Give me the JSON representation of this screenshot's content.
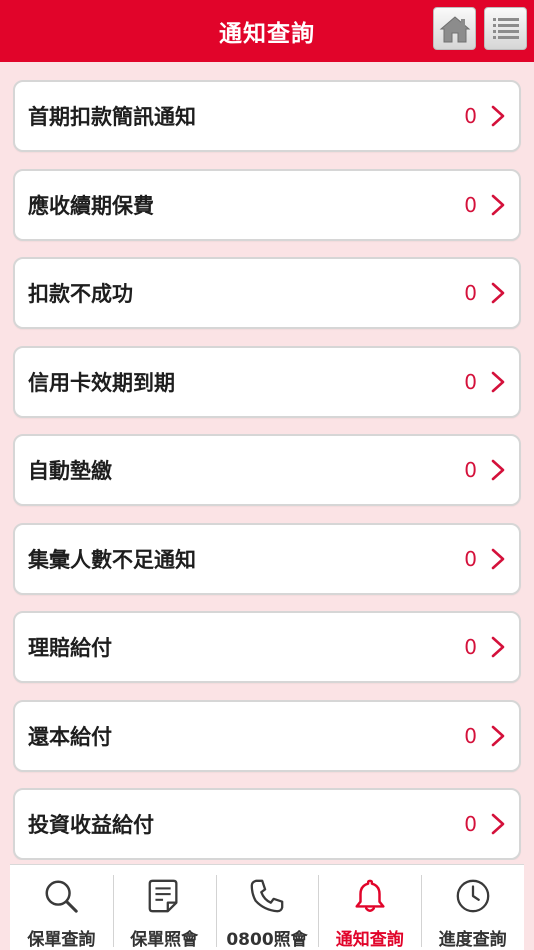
{
  "header": {
    "title": "通知查詢"
  },
  "notifications": [
    {
      "label": "首期扣款簡訊通知",
      "count": "0"
    },
    {
      "label": "應收續期保費",
      "count": "0"
    },
    {
      "label": "扣款不成功",
      "count": "0"
    },
    {
      "label": "信用卡效期到期",
      "count": "0"
    },
    {
      "label": "自動墊繳",
      "count": "0"
    },
    {
      "label": "集彙人數不足通知",
      "count": "0"
    },
    {
      "label": "理賠給付",
      "count": "0"
    },
    {
      "label": "還本給付",
      "count": "0"
    },
    {
      "label": "投資收益給付",
      "count": "0"
    }
  ],
  "tabs": [
    {
      "label": "保單查詢",
      "icon": "search-icon"
    },
    {
      "label": "保單照會",
      "icon": "document-icon"
    },
    {
      "label": "0800照會",
      "icon": "phone-icon"
    },
    {
      "label": "通知查詢",
      "icon": "bell-icon"
    },
    {
      "label": "進度查詢",
      "icon": "clock-icon"
    }
  ],
  "colors": {
    "brand": "#e1042a",
    "accent": "#d4113b",
    "background": "#fbe3e5"
  }
}
